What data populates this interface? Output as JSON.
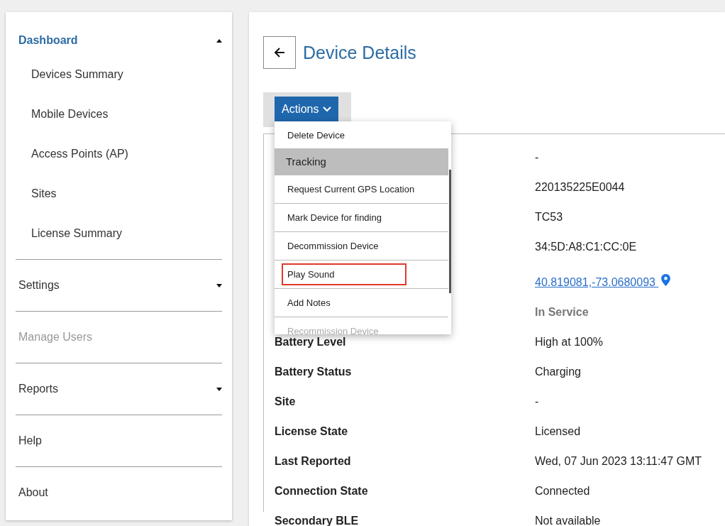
{
  "sidebar": {
    "sections": [
      {
        "kind": "group",
        "label": "Dashboard",
        "selected": true,
        "disabled": false,
        "expanded": true,
        "children": [
          {
            "label": "Devices Summary"
          },
          {
            "label": "Mobile Devices"
          },
          {
            "label": "Access Points (AP)"
          },
          {
            "label": "Sites"
          },
          {
            "label": "License Summary"
          }
        ]
      },
      {
        "kind": "group",
        "label": "Settings",
        "selected": false,
        "disabled": false,
        "expanded": false
      },
      {
        "kind": "link",
        "label": "Manage Users",
        "selected": false,
        "disabled": true
      },
      {
        "kind": "group",
        "label": "Reports",
        "selected": false,
        "disabled": false,
        "expanded": false
      },
      {
        "kind": "link",
        "label": "Help",
        "selected": false,
        "disabled": false
      },
      {
        "kind": "link",
        "label": "About",
        "selected": false,
        "disabled": false
      }
    ]
  },
  "page": {
    "title": "Device Details"
  },
  "actions": {
    "label": "Actions",
    "expanded": true,
    "menu": [
      {
        "kind": "item",
        "label": "Delete Device",
        "disabled": false,
        "outlined": false
      },
      {
        "kind": "header",
        "label": "Tracking",
        "disabled": false,
        "outlined": false
      },
      {
        "kind": "item",
        "label": "Request Current GPS Location",
        "disabled": false,
        "outlined": false
      },
      {
        "kind": "item",
        "label": "Mark Device for finding",
        "disabled": false,
        "outlined": false
      },
      {
        "kind": "item",
        "label": "Decommission Device",
        "disabled": false,
        "outlined": false
      },
      {
        "kind": "item",
        "label": "Play Sound",
        "disabled": false,
        "outlined": true
      },
      {
        "kind": "item",
        "label": "Add Notes",
        "disabled": false,
        "outlined": false
      },
      {
        "kind": "item",
        "label": "Recommission Device",
        "disabled": true,
        "outlined": false
      }
    ]
  },
  "details": [
    {
      "kind": "text",
      "value": "-"
    },
    {
      "kind": "text",
      "value": "220135225E0044"
    },
    {
      "kind": "text",
      "value": "TC53"
    },
    {
      "kind": "text",
      "value": "34:5D:A8:C1:CC:0E"
    },
    {
      "kind": "location",
      "value": "40.819081,-73.0680093 "
    },
    {
      "kind": "status",
      "value": "In Service"
    },
    {
      "kind": "text",
      "label": "Battery Level",
      "value": "High at 100%"
    },
    {
      "kind": "text",
      "label": "Battery Status",
      "value": "Charging"
    },
    {
      "kind": "text",
      "label": "Site",
      "value": "-"
    },
    {
      "kind": "text",
      "label": "License State",
      "value": "Licensed"
    },
    {
      "kind": "text",
      "label": "Last Reported",
      "value": "Wed, 07 Jun 2023 13:11:47 GMT"
    },
    {
      "kind": "text",
      "label": "Connection State",
      "value": "Connected"
    },
    {
      "kind": "text",
      "label": "Secondary BLE",
      "value": "Not available"
    }
  ]
}
